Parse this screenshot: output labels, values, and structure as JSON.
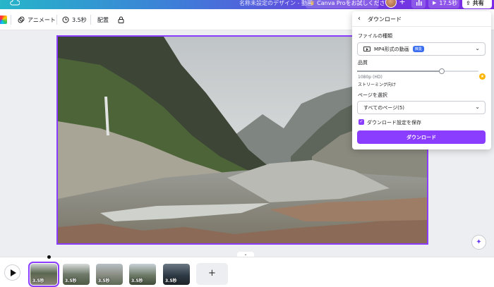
{
  "header": {
    "doc_title": "名称未設定のデザイン - 動画",
    "pro_button": "Canva Proをお試しください",
    "play_duration": "17.5秒",
    "share_label": "共有"
  },
  "toolbar": {
    "animate_label": "アニメート",
    "duration_label": "3.5秒",
    "position_label": "配置"
  },
  "download_panel": {
    "title": "ダウンロード",
    "file_type_label": "ファイルの種類",
    "file_type_value": "MP4形式の動画",
    "file_type_badge": "推奨",
    "quality_label": "品質",
    "quality_value": "1080p (HD)",
    "quality_note": "ストリーミング向け",
    "quality_level": 0.7,
    "pages_label": "ページを選択",
    "pages_value": "すべてのページ(5)",
    "save_settings_label": "ダウンロード設定を保存",
    "save_settings_checked": true,
    "download_button": "ダウンロード"
  },
  "timeline": {
    "pages": [
      {
        "duration": "3.5秒",
        "selected": true
      },
      {
        "duration": "3.5秒",
        "selected": false
      },
      {
        "duration": "3.5秒",
        "selected": false
      },
      {
        "duration": "3.5秒",
        "selected": false
      },
      {
        "duration": "3.5秒",
        "selected": false
      }
    ],
    "add_page_label": "+"
  },
  "colors": {
    "accent": "#8b3dff",
    "badge": "#3a6df0"
  }
}
